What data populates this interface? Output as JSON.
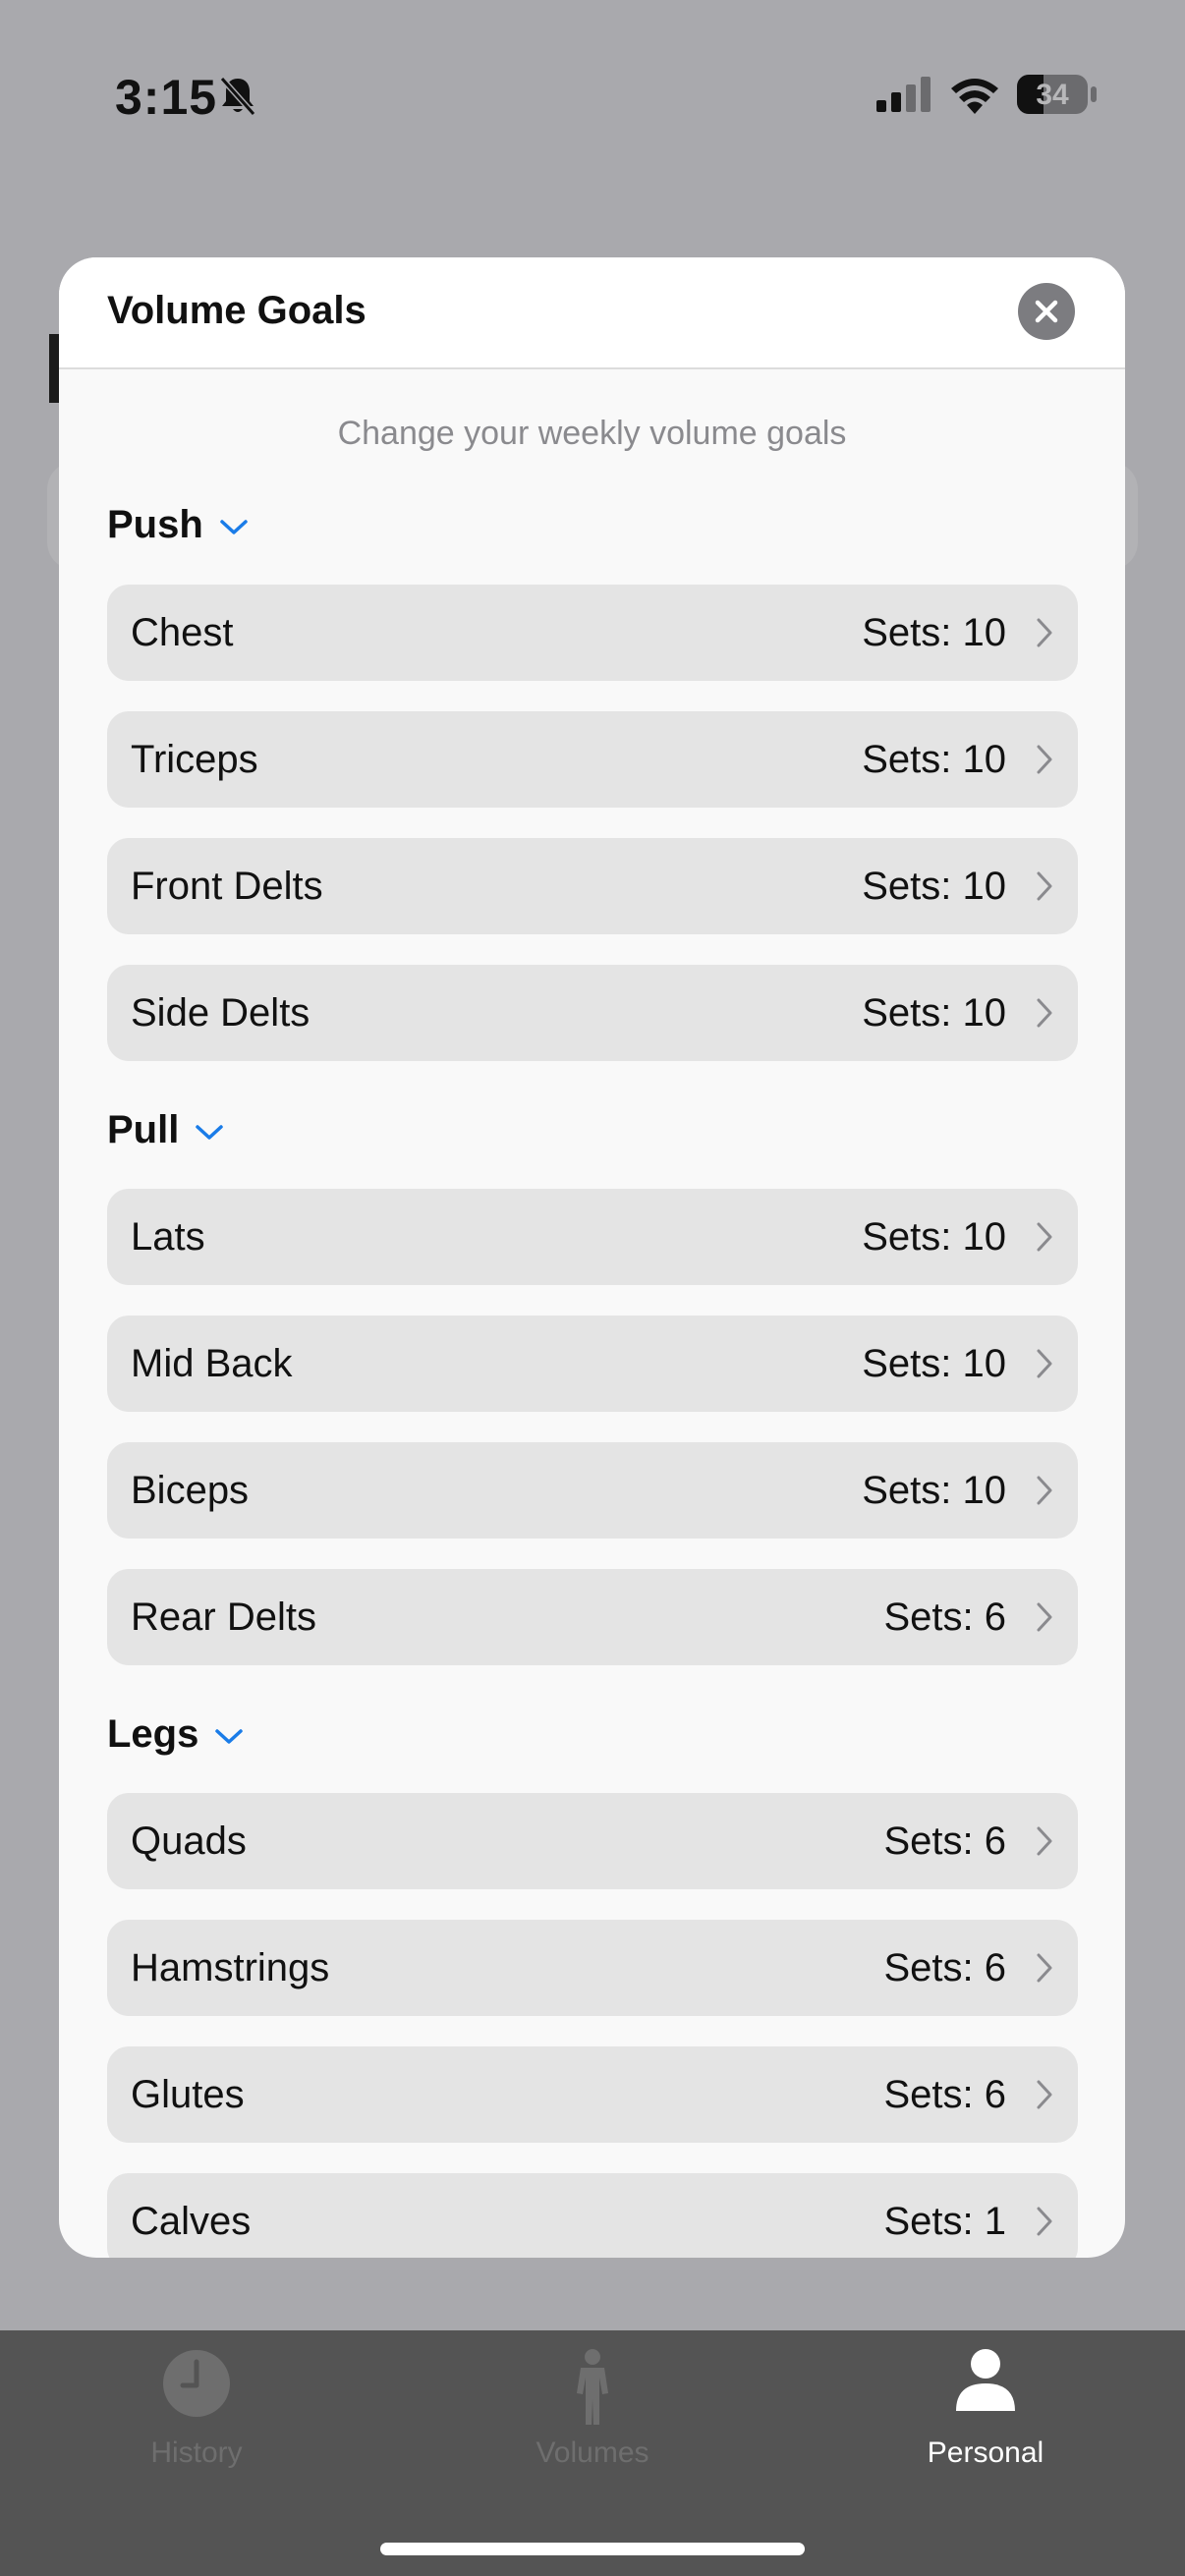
{
  "status_bar": {
    "time": "3:15",
    "battery": "34"
  },
  "modal": {
    "title": "Volume Goals",
    "subtitle": "Change your weekly volume goals",
    "groups": [
      {
        "name": "Push",
        "items": [
          {
            "label": "Chest",
            "value": "Sets: 10"
          },
          {
            "label": "Triceps",
            "value": "Sets: 10"
          },
          {
            "label": "Front Delts",
            "value": "Sets: 10"
          },
          {
            "label": "Side Delts",
            "value": "Sets: 10"
          }
        ]
      },
      {
        "name": "Pull",
        "items": [
          {
            "label": "Lats",
            "value": "Sets: 10"
          },
          {
            "label": "Mid Back",
            "value": "Sets: 10"
          },
          {
            "label": "Biceps",
            "value": "Sets: 10"
          },
          {
            "label": "Rear Delts",
            "value": "Sets: 6"
          }
        ]
      },
      {
        "name": "Legs",
        "items": [
          {
            "label": "Quads",
            "value": "Sets: 6"
          },
          {
            "label": "Hamstrings",
            "value": "Sets: 6"
          },
          {
            "label": "Glutes",
            "value": "Sets: 6"
          },
          {
            "label": "Calves",
            "value": "Sets: 1"
          }
        ]
      }
    ]
  },
  "tab_bar": {
    "tabs": [
      {
        "label": "History",
        "icon": "clock-icon"
      },
      {
        "label": "Volumes",
        "icon": "figure-icon"
      },
      {
        "label": "Personal",
        "icon": "person-icon",
        "active": true
      }
    ]
  },
  "colors": {
    "accent": "#1a7ce8",
    "row_bg": "#e4e4e4",
    "dim_bg": "#a9a9ad"
  }
}
